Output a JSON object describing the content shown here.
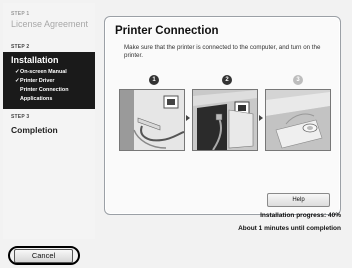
{
  "sidebar": {
    "steps": [
      {
        "number": "STEP 1",
        "title": "License Agreement"
      },
      {
        "number": "STEP 2",
        "title": "Installation",
        "substeps": [
          {
            "check": "✓",
            "label": "On-screen Manual"
          },
          {
            "check": "✓",
            "label": "Printer Driver"
          },
          {
            "check": "",
            "label": "Printer Connection"
          },
          {
            "check": "",
            "label": "Applications"
          }
        ]
      },
      {
        "number": "STEP 3",
        "title": "Completion"
      }
    ]
  },
  "panel": {
    "title": "Printer Connection",
    "description": "Make sure that the printer is connected to the computer, and turn on the printer.",
    "illustration_steps": [
      "1",
      "2",
      "3"
    ],
    "help_label": "Help"
  },
  "status": {
    "progress_text": "Installation progress: 40%",
    "eta_text": "About 1 minutes until completion",
    "progress_fraction": 0.4
  },
  "footer": {
    "cancel_label": "Cancel"
  }
}
